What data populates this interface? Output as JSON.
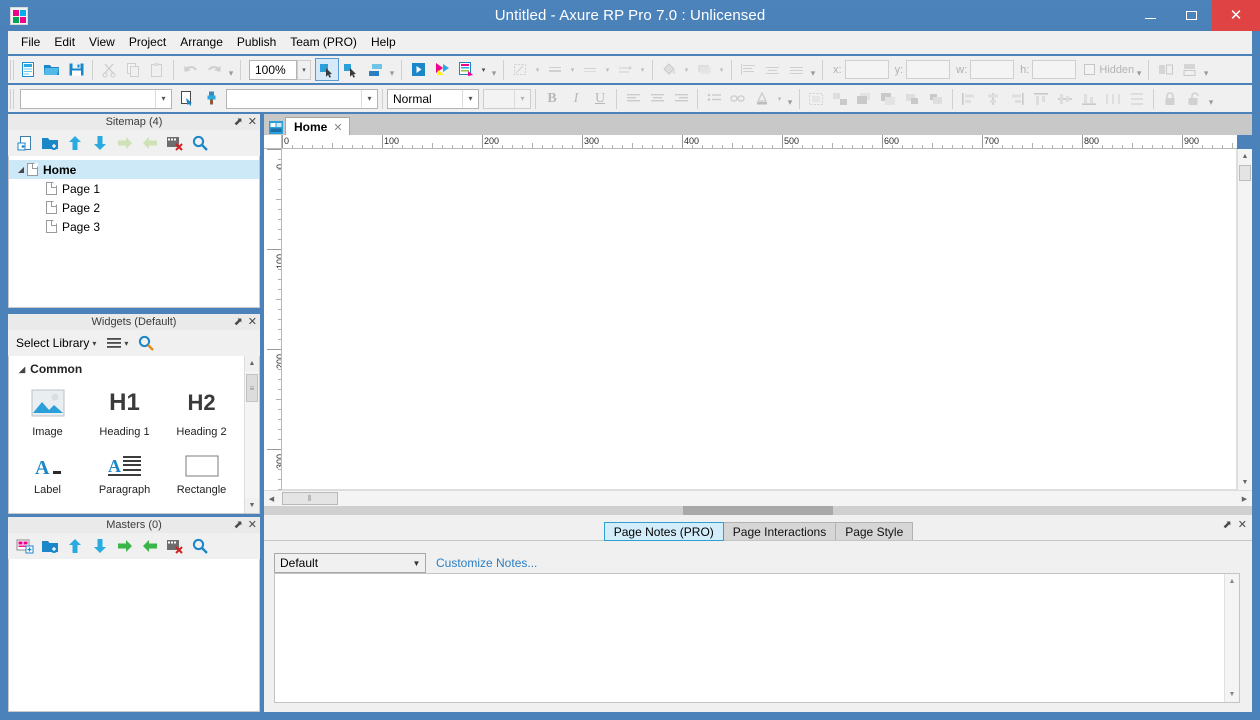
{
  "window": {
    "title": "Untitled - Axure RP Pro 7.0 : Unlicensed",
    "logo_name": "axure-logo",
    "minimize": "–",
    "maximize": "□",
    "close": "✕"
  },
  "menubar": {
    "items": [
      "File",
      "Edit",
      "View",
      "Project",
      "Arrange",
      "Publish",
      "Team (PRO)",
      "Help"
    ]
  },
  "toolbar1": {
    "zoom_value": "100%",
    "buttons": [
      {
        "name": "new-file-button",
        "icon": "new-file-icon",
        "enabled": true
      },
      {
        "name": "open-file-button",
        "icon": "open-folder-icon",
        "enabled": true
      },
      {
        "name": "save-button",
        "icon": "save-disk-icon",
        "enabled": true
      },
      {
        "name": "cut-button",
        "icon": "scissors-icon",
        "enabled": false
      },
      {
        "name": "copy-button",
        "icon": "copy-icon",
        "enabled": false
      },
      {
        "name": "paste-button",
        "icon": "paste-icon",
        "enabled": false
      },
      {
        "name": "undo-button",
        "icon": "undo-arrow-icon",
        "enabled": false
      },
      {
        "name": "redo-button",
        "icon": "redo-arrow-icon",
        "enabled": false
      }
    ],
    "pointer_tools": [
      {
        "name": "selection-tool-button",
        "icon": "pointer-select-icon",
        "selected": true
      },
      {
        "name": "connector-tool-button",
        "icon": "pointer-connector-icon",
        "selected": false
      },
      {
        "name": "slice-tool-button",
        "icon": "slice-image-icon",
        "selected": false
      }
    ],
    "preview_tools": [
      {
        "name": "preview-button",
        "icon": "preview-play-icon",
        "enabled": true
      },
      {
        "name": "publish-button",
        "icon": "publish-share-icon",
        "enabled": true
      },
      {
        "name": "generate-prototype-button",
        "icon": "generate-html-icon",
        "enabled": true
      }
    ],
    "style_tools": [
      {
        "name": "fill-color-button",
        "icon": "fill-swatch-icon",
        "enabled": false
      },
      {
        "name": "line-width-button",
        "icon": "line-weight-icon",
        "enabled": false
      },
      {
        "name": "line-style-button",
        "icon": "line-style-icon",
        "enabled": false
      },
      {
        "name": "arrow-style-button",
        "icon": "arrow-style-icon",
        "enabled": false
      },
      {
        "name": "paint-bucket-button",
        "icon": "paint-bucket-icon",
        "enabled": false
      },
      {
        "name": "shadow-button",
        "icon": "shadow-icon",
        "enabled": false
      },
      {
        "name": "text-pad-top-button",
        "icon": "pad-top-icon",
        "enabled": false
      },
      {
        "name": "text-pad-middle-button",
        "icon": "pad-middle-icon",
        "enabled": false
      },
      {
        "name": "text-pad-bottom-button",
        "icon": "pad-bottom-icon",
        "enabled": false
      }
    ],
    "geometry": {
      "x_label": "x:",
      "x_value": "",
      "y_label": "y:",
      "y_value": "",
      "w_label": "w:",
      "w_value": "",
      "h_label": "h:",
      "h_value": "",
      "hidden_label": "Hidden"
    },
    "right_tools": [
      {
        "name": "flip-horizontal-button",
        "icon": "flip-horizontal-icon",
        "enabled": false
      },
      {
        "name": "flip-vertical-button",
        "icon": "flip-vertical-icon",
        "enabled": false
      }
    ]
  },
  "toolbar2": {
    "font_family_value": "",
    "font_family_placeholder": "",
    "font_size_value": "",
    "style_value": "Normal",
    "style_value2": "",
    "format_buttons": [
      {
        "name": "bold-button",
        "label": "B"
      },
      {
        "name": "italic-button",
        "label": "I"
      },
      {
        "name": "underline-button",
        "label": "U"
      }
    ],
    "align_buttons": [
      {
        "name": "align-left-button",
        "icon": "align-left-icon"
      },
      {
        "name": "align-center-button",
        "icon": "align-center-icon"
      },
      {
        "name": "align-right-button",
        "icon": "align-right-icon"
      }
    ],
    "list_buttons": [
      {
        "name": "bullet-list-button",
        "icon": "bullet-list-icon"
      },
      {
        "name": "hyperlink-button",
        "icon": "link-chain-icon"
      },
      {
        "name": "font-color-button",
        "icon": "font-color-icon"
      }
    ],
    "style_painter": [
      {
        "name": "style-pick-button",
        "icon": "style-picker-icon"
      },
      {
        "name": "format-painter-button",
        "icon": "paint-brush-icon"
      }
    ],
    "arrange_buttons": [
      {
        "name": "group-button",
        "icon": "group-icon"
      },
      {
        "name": "ungroup-button",
        "icon": "ungroup-icon"
      },
      {
        "name": "bring-front-button",
        "icon": "bring-front-icon"
      },
      {
        "name": "send-back-button",
        "icon": "send-back-icon"
      },
      {
        "name": "bring-forward-button",
        "icon": "bring-forward-icon"
      },
      {
        "name": "send-backward-button",
        "icon": "send-backward-icon"
      },
      {
        "name": "align-objects-left-button",
        "icon": "align-objects-left-icon"
      },
      {
        "name": "align-objects-center-button",
        "icon": "align-objects-center-icon"
      },
      {
        "name": "align-objects-right-button",
        "icon": "align-objects-right-icon"
      },
      {
        "name": "align-objects-top-button",
        "icon": "align-objects-top-icon"
      },
      {
        "name": "align-objects-middle-button",
        "icon": "align-objects-middle-icon"
      },
      {
        "name": "align-objects-bottom-button",
        "icon": "align-objects-bottom-icon"
      },
      {
        "name": "distribute-horizontal-button",
        "icon": "distribute-horizontal-icon"
      },
      {
        "name": "distribute-vertical-button",
        "icon": "distribute-vertical-icon"
      },
      {
        "name": "lock-button",
        "icon": "lock-closed-icon"
      },
      {
        "name": "unlock-button",
        "icon": "lock-open-icon"
      }
    ]
  },
  "sitemap": {
    "title": "Sitemap (4)",
    "maximize_glyph": "⬈",
    "close_glyph": "✕",
    "toolbar": [
      {
        "name": "add-page-button",
        "icon": "add-page-icon",
        "enabled": true
      },
      {
        "name": "add-folder-button",
        "icon": "add-folder-icon",
        "enabled": true
      },
      {
        "name": "move-up-button",
        "icon": "arrow-up-icon",
        "enabled": true
      },
      {
        "name": "move-down-button",
        "icon": "arrow-down-icon",
        "enabled": true
      },
      {
        "name": "indent-button",
        "icon": "arrow-right-icon",
        "enabled": false
      },
      {
        "name": "outdent-button",
        "icon": "arrow-left-icon",
        "enabled": false
      },
      {
        "name": "delete-page-button",
        "icon": "delete-page-icon",
        "enabled": true
      },
      {
        "name": "search-button",
        "icon": "search-icon",
        "enabled": true
      }
    ],
    "tree": [
      {
        "label": "Home",
        "level": 0,
        "selected": true,
        "expander": "▼"
      },
      {
        "label": "Page 1",
        "level": 1,
        "selected": false,
        "expander": ""
      },
      {
        "label": "Page 2",
        "level": 1,
        "selected": false,
        "expander": ""
      },
      {
        "label": "Page 3",
        "level": 1,
        "selected": false,
        "expander": ""
      }
    ]
  },
  "widgets": {
    "title": "Widgets (Default)",
    "maximize_glyph": "⬈",
    "close_glyph": "✕",
    "select_library_label": "Select Library",
    "select_library_caret": "▾",
    "menu_icon": "list-menu-icon",
    "menu_caret": "▾",
    "search_icon": "search-icon",
    "group_label": "Common",
    "group_expander": "▼",
    "items": [
      {
        "label": "Image",
        "icon": "image-widget-icon"
      },
      {
        "label": "Heading 1",
        "icon": "heading1-widget-icon",
        "glyph": "H1"
      },
      {
        "label": "Heading 2",
        "icon": "heading2-widget-icon",
        "glyph": "H2"
      },
      {
        "label": "Label",
        "icon": "label-widget-icon"
      },
      {
        "label": "Paragraph",
        "icon": "paragraph-widget-icon"
      },
      {
        "label": "Rectangle",
        "icon": "rectangle-widget-icon"
      }
    ]
  },
  "masters": {
    "title": "Masters (0)",
    "maximize_glyph": "⬈",
    "close_glyph": "✕",
    "toolbar": [
      {
        "name": "add-master-button",
        "icon": "add-master-icon",
        "enabled": true
      },
      {
        "name": "add-folder-button",
        "icon": "add-folder-icon",
        "enabled": true
      },
      {
        "name": "move-up-button",
        "icon": "arrow-up-icon",
        "enabled": true
      },
      {
        "name": "move-down-button",
        "icon": "arrow-down-icon",
        "enabled": true
      },
      {
        "name": "indent-button",
        "icon": "arrow-right-icon",
        "enabled": true
      },
      {
        "name": "outdent-button",
        "icon": "arrow-left-icon",
        "enabled": true
      },
      {
        "name": "delete-master-button",
        "icon": "delete-master-icon",
        "enabled": true
      },
      {
        "name": "search-button",
        "icon": "search-icon",
        "enabled": true
      }
    ]
  },
  "editor": {
    "tab_label": "Home",
    "tab_close": "✕",
    "tab_icon": "page-tab-icon",
    "ruler_h_ticks": [
      "0",
      "100",
      "200",
      "300",
      "400",
      "500",
      "600",
      "700",
      "800",
      "900"
    ],
    "ruler_v_ticks": [
      "0",
      "100",
      "200",
      "300"
    ],
    "hscroll_thumb_glyph": "⦀",
    "hscroll_left": "◀",
    "hscroll_right": "▶",
    "vscroll_up": "▲",
    "vscroll_down": "▼"
  },
  "bottom": {
    "maximize_glyph": "⬈",
    "close_glyph": "✕",
    "tabs": [
      {
        "label": "Page Notes (PRO)",
        "name": "tab-page-notes",
        "active": true
      },
      {
        "label": "Page Interactions",
        "name": "tab-page-interactions",
        "active": false
      },
      {
        "label": "Page Style",
        "name": "tab-page-style",
        "active": false
      }
    ],
    "notes_select_value": "Default",
    "notes_select_caret": "▼",
    "customize_link": "Customize Notes...",
    "notes_text": "",
    "notes_scroll_up": "▲",
    "notes_scroll_down": "▼"
  },
  "colors": {
    "title_bar": "#4a82b9",
    "accent_blue": "#2b7ec1",
    "active_tab_bg": "#d4edfb",
    "active_tab_border": "#2e9fd4",
    "tree_selection": "#cde8f6",
    "close_button": "#e04343"
  }
}
